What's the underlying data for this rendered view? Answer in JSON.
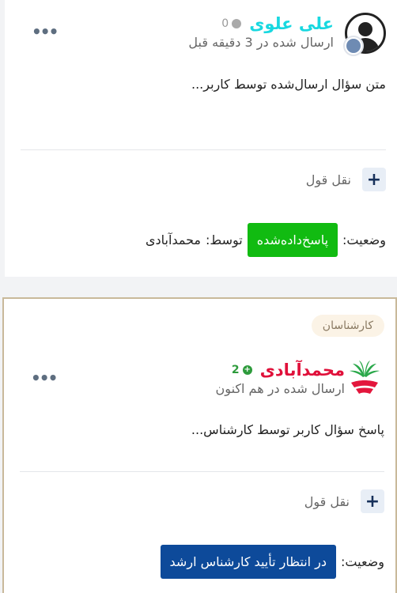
{
  "posts": [
    {
      "author": "علی علوی",
      "score": "0",
      "time": "ارسال شده در 3 دقیقه قبل",
      "body": "متن سؤال ارسال‌شده توسط کاربر...",
      "quote_label": "نقل قول",
      "status_label": "وضعیت:",
      "status": "پاسخ‌داده‌شده",
      "by_label": "توسط:",
      "by_name": "محمدآبادی",
      "avatar_icon": "user-avatar-icon",
      "badge_icon": "hand-badge-icon"
    },
    {
      "tag": "کارشناسان",
      "author": "محمدآبادی",
      "score": "2",
      "time": "ارسال شده در هم اکنون",
      "body": "پاسخ سؤال کاربر توسط کارشناس...",
      "quote_label": "نقل قول",
      "status_label": "وضعیت:",
      "status": "در انتظار تأیید کارشناس ارشد",
      "logo_icon": "brand-logo-icon"
    }
  ],
  "colors": {
    "author1": "#18d8e0",
    "author2": "#e0103a",
    "answered": "#11bb11",
    "pending": "#0d4a9a",
    "score_positive": "#2e9b3c"
  }
}
